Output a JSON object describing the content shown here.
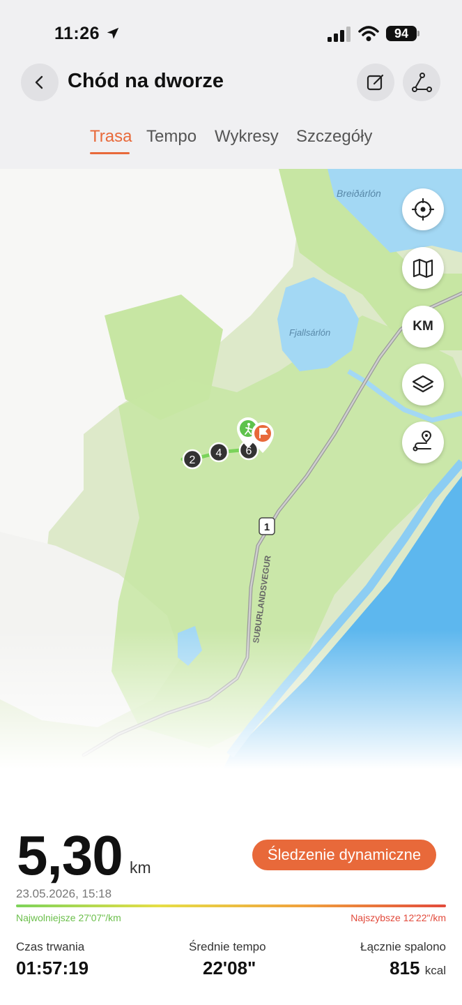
{
  "status_bar": {
    "time": "11:26",
    "battery": "94"
  },
  "header": {
    "title": "Chód na dworze",
    "tabs": [
      {
        "label": "Trasa",
        "active": true
      },
      {
        "label": "Tempo",
        "active": false
      },
      {
        "label": "Wykresy",
        "active": false
      },
      {
        "label": "Szczegóły",
        "active": false
      }
    ]
  },
  "map": {
    "labels": {
      "lagoon_north": "Breiðárlón",
      "lagoon_mid": "Fjallsárlón",
      "road_name": "SUÐURLANDSVEGUR",
      "road_number": "1"
    },
    "km_markers": [
      "2",
      "4",
      "6"
    ],
    "controls": {
      "units_label": "KM"
    },
    "colors": {
      "water": "#a3d8f4",
      "sea": "#5db7ee",
      "vegetation": "#c7e6a3",
      "glacier": "#fafafa",
      "route": "#7ad35a",
      "start_marker": "#5ec24c",
      "finish_marker": "#e8693a"
    }
  },
  "summary": {
    "distance": "5,30",
    "distance_unit": "km",
    "dynamic_tracking_label": "Śledzenie dynamiczne",
    "date": "23.05.2026, 15:18",
    "slowest": "Najwolniejsze 27'07\"/km",
    "fastest": "Najszybsze 12'22\"/km",
    "duration": {
      "label": "Czas trwania",
      "value": "01:57:19"
    },
    "avg_pace": {
      "label": "Średnie tempo",
      "value": "22'08\""
    },
    "calories": {
      "label": "Łącznie spalono",
      "value": "815",
      "unit": "kcal"
    }
  },
  "accent_color": "#e8693a"
}
